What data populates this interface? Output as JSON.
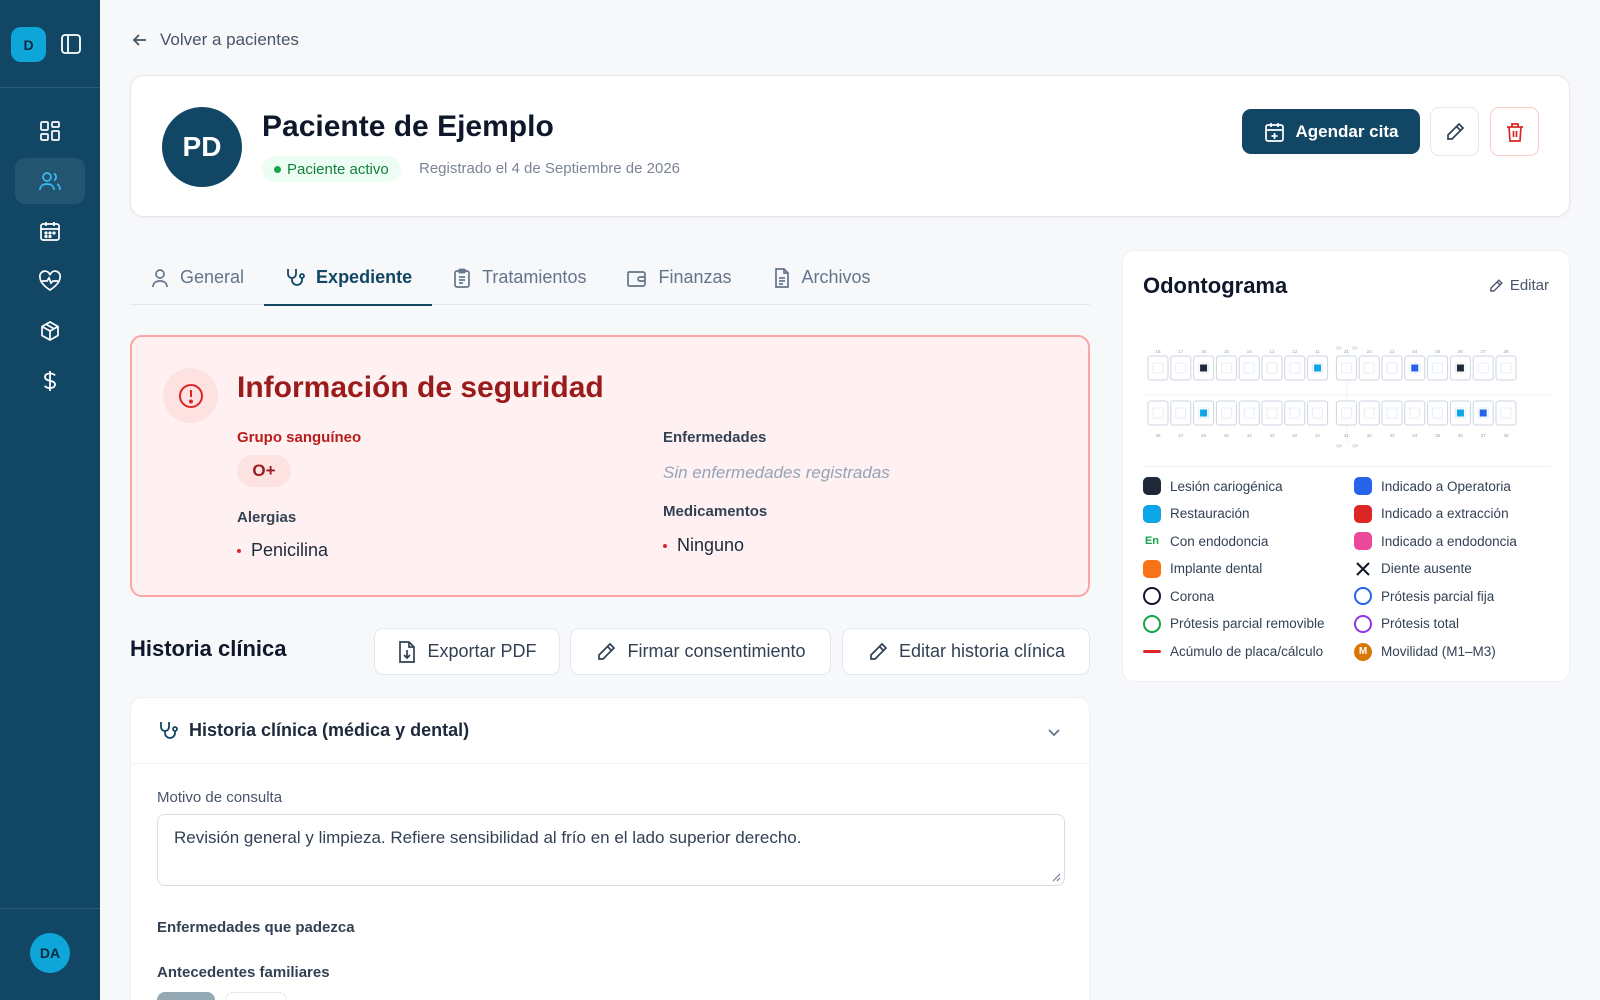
{
  "sidebar": {
    "logo_letter": "D",
    "user_initials": "DA",
    "items": [
      {
        "name": "dashboard",
        "icon": "dashboard-icon",
        "active": false
      },
      {
        "name": "patients",
        "icon": "users-icon",
        "active": true
      },
      {
        "name": "calendar",
        "icon": "calendar-icon",
        "active": false
      },
      {
        "name": "health",
        "icon": "heart-pulse-icon",
        "active": false
      },
      {
        "name": "inventory",
        "icon": "package-icon",
        "active": false
      },
      {
        "name": "finance",
        "icon": "dollar-icon",
        "active": false
      }
    ]
  },
  "back_link": "Volver a pacientes",
  "patient": {
    "initials": "PD",
    "name": "Paciente de Ejemplo",
    "status": "Paciente activo",
    "registered": "Registrado el 4 de Septiembre de 2026",
    "schedule_label": "Agendar cita"
  },
  "tabs": [
    {
      "label": "General",
      "icon": "user-icon",
      "active": false
    },
    {
      "label": "Expediente",
      "icon": "stethoscope-icon",
      "active": true
    },
    {
      "label": "Tratamientos",
      "icon": "clipboard-icon",
      "active": false
    },
    {
      "label": "Finanzas",
      "icon": "wallet-icon",
      "active": false
    },
    {
      "label": "Archivos",
      "icon": "file-icon",
      "active": false
    }
  ],
  "security": {
    "title": "Información de seguridad",
    "blood_label": "Grupo sanguíneo",
    "blood_value": "O+",
    "allergies_label": "Alergias",
    "allergies": [
      "Penicilina"
    ],
    "diseases_label": "Enfermedades",
    "diseases_empty": "Sin enfermedades registradas",
    "medications_label": "Medicamentos",
    "medications": [
      "Ninguno"
    ]
  },
  "history": {
    "title": "Historia clínica",
    "export_label": "Exportar PDF",
    "sign_label": "Firmar consentimiento",
    "edit_label": "Editar historia clínica",
    "section_title": "Historia clínica (médica y dental)",
    "reason_label": "Motivo de consulta",
    "reason_value": "Revisión general y limpieza. Refiere sensibilidad al frío en el lado superior derecho.",
    "diseases_label": "Enfermedades que padezca",
    "family_label": "Antecedentes familiares"
  },
  "odontogram": {
    "title": "Odontograma",
    "edit_label": "Editar",
    "upper_numbers": [
      "18",
      "17",
      "16",
      "15",
      "14",
      "13",
      "12",
      "11",
      "21",
      "22",
      "23",
      "24",
      "25",
      "26",
      "27",
      "28"
    ],
    "lower_numbers": [
      "48",
      "47",
      "46",
      "45",
      "44",
      "43",
      "42",
      "41",
      "31",
      "32",
      "33",
      "34",
      "35",
      "36",
      "37",
      "38"
    ],
    "quadrant_labels": [
      "Q1",
      "Q2",
      "Q4",
      "Q3"
    ],
    "upper_marks": [
      "",
      "",
      "lesion",
      "",
      "",
      "",
      "",
      "restoration",
      "",
      "",
      "",
      "operatory",
      "",
      "lesion",
      "",
      ""
    ],
    "lower_marks": [
      "",
      "",
      "restoration",
      "",
      "",
      "",
      "",
      "",
      "",
      "",
      "",
      "",
      "",
      "restoration",
      "operatory",
      ""
    ],
    "legend": [
      {
        "label": "Lesión cariogénica",
        "kind": "fill",
        "color": "#1f2937"
      },
      {
        "label": "Indicado a Operatoria",
        "kind": "fill",
        "color": "#2563eb"
      },
      {
        "label": "Restauración",
        "kind": "fill",
        "color": "#0ea5e9"
      },
      {
        "label": "Indicado a extracción",
        "kind": "fill",
        "color": "#dc2626"
      },
      {
        "label": "Con endodoncia",
        "kind": "text",
        "symbol": "En",
        "color": "#16a34a"
      },
      {
        "label": "Indicado a endodoncia",
        "kind": "fill",
        "color": "#ec4899"
      },
      {
        "label": "Implante dental",
        "kind": "fill",
        "color": "#f97316"
      },
      {
        "label": "Diente ausente",
        "kind": "cross",
        "color": "#111827"
      },
      {
        "label": "Corona",
        "kind": "ring",
        "color": "#111827"
      },
      {
        "label": "Prótesis parcial fija",
        "kind": "ring",
        "color": "#2563eb"
      },
      {
        "label": "Prótesis parcial removible",
        "kind": "ring",
        "color": "#16a34a"
      },
      {
        "label": "Prótesis total",
        "kind": "ring",
        "color": "#9333ea"
      },
      {
        "label": "Acúmulo de placa/cálculo",
        "kind": "line",
        "color": "#dc2626"
      },
      {
        "label": "Movilidad (M1–M3)",
        "kind": "badge",
        "symbol": "M",
        "color": "#d97706"
      }
    ]
  },
  "colors": {
    "sidebar": "#114764",
    "accent": "#0ea5d8",
    "danger": "#dc2626",
    "success": "#16a34a"
  }
}
